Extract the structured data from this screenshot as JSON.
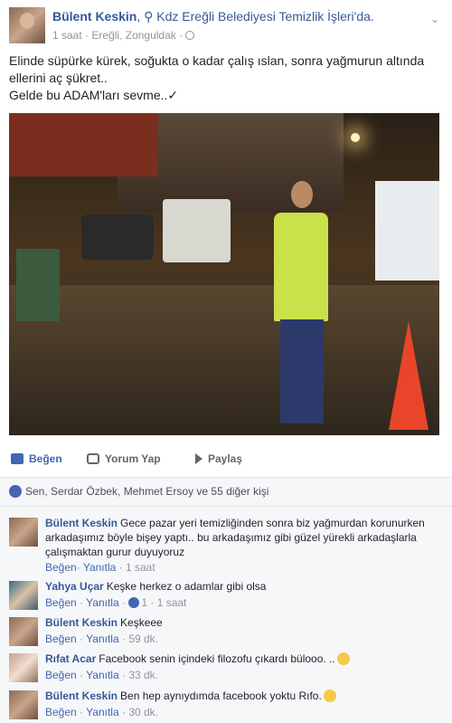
{
  "post": {
    "author": "Bülent Keskin",
    "location_prefix": "Kdz Ereğli Belediyesi Temizlik İşleri'da.",
    "time": "1 saat",
    "place": "Ereğli, Zonguldak",
    "text_line1": "Elinde süpürke kürek, soğukta o kadar çalış ıslan, sonra yağmurun altında",
    "text_line2": "ellerini aç şükret..",
    "text_line3": "Gelde bu ADAM'ları sevme..✓"
  },
  "actions": {
    "like": "Beğen",
    "comment": "Yorum Yap",
    "share": "Paylaş"
  },
  "likes_summary": "Sen, Serdar Özbek, Mehmet Ersoy ve 55 diğer kişi",
  "comments": [
    {
      "name": "Bülent Keskin",
      "lines": [
        "Gece pazar yeri temizliğinden sonra biz yağmurdan korunurken",
        "arkadaşımız böyle bişey yaptı.. bu arkadaşımız gibi güzel yürekli arkadaşlarla",
        "çalışmaktan gurur duyuyoruz"
      ],
      "like": "Beğen",
      "reply": "Yanıtla",
      "time": "1 saat"
    },
    {
      "name": "Yahya Uçar",
      "lines": [
        "Keşke herkez o adamlar gibi olsa"
      ],
      "like": "Beğen",
      "reply": "Yanıtla",
      "reactions": "1",
      "time": "1 saat"
    },
    {
      "name": "Bülent Keskin",
      "lines": [
        "Keşkeee"
      ],
      "like": "Beğen",
      "reply": "Yanıtla",
      "time": "59 dk."
    },
    {
      "name": "Rıfat Acar",
      "lines": [
        "Facebook senin içindeki filozofu çıkardı bülooo. .."
      ],
      "like": "Beğen",
      "reply": "Yanıtla",
      "time": "33 dk."
    },
    {
      "name": "Bülent Keskin",
      "lines": [
        "Ben hep aynıydımda facebook yoktu Rıfo."
      ],
      "like": "Beğen",
      "reply": "Yanıtla",
      "time": "30 dk."
    }
  ],
  "sep_dot": "·",
  "colors": {
    "link": "#365899",
    "accent": "#4267b2",
    "muted": "#90949c",
    "comments_bg": "#f6f7f9"
  },
  "icons": [
    "globe-icon",
    "location-pin-icon",
    "chevron-down-icon",
    "like-icon",
    "comment-icon",
    "share-icon",
    "smile-emoji-icon"
  ]
}
